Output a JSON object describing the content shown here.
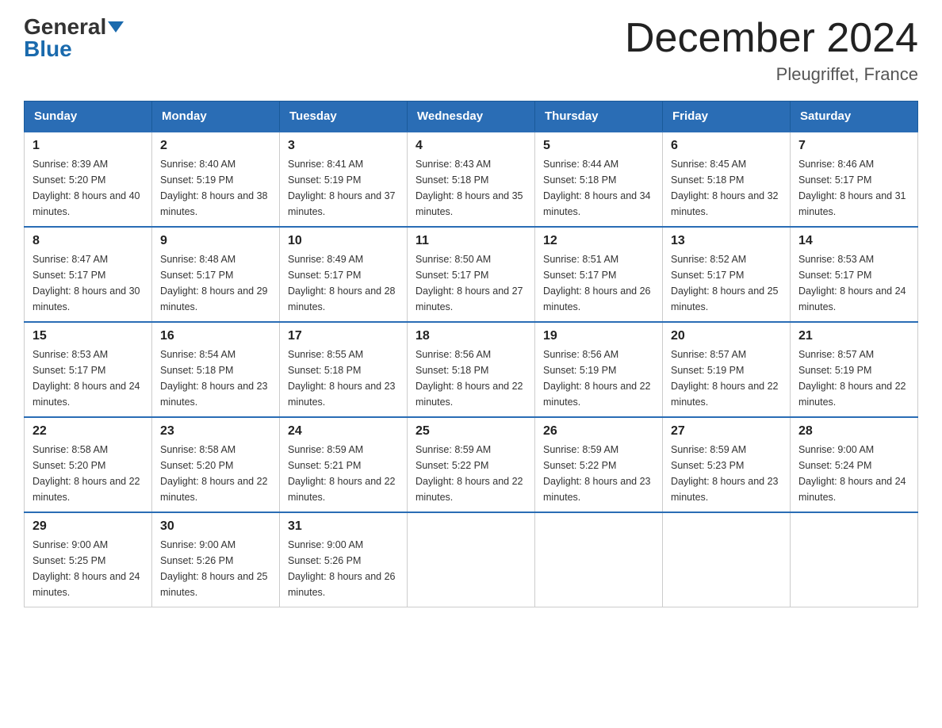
{
  "header": {
    "logo": {
      "general": "General",
      "blue": "Blue",
      "triangle": true
    },
    "title": "December 2024",
    "location": "Pleugriffet, France"
  },
  "calendar": {
    "days_of_week": [
      "Sunday",
      "Monday",
      "Tuesday",
      "Wednesday",
      "Thursday",
      "Friday",
      "Saturday"
    ],
    "weeks": [
      [
        {
          "day": "1",
          "sunrise": "8:39 AM",
          "sunset": "5:20 PM",
          "daylight": "8 hours and 40 minutes."
        },
        {
          "day": "2",
          "sunrise": "8:40 AM",
          "sunset": "5:19 PM",
          "daylight": "8 hours and 38 minutes."
        },
        {
          "day": "3",
          "sunrise": "8:41 AM",
          "sunset": "5:19 PM",
          "daylight": "8 hours and 37 minutes."
        },
        {
          "day": "4",
          "sunrise": "8:43 AM",
          "sunset": "5:18 PM",
          "daylight": "8 hours and 35 minutes."
        },
        {
          "day": "5",
          "sunrise": "8:44 AM",
          "sunset": "5:18 PM",
          "daylight": "8 hours and 34 minutes."
        },
        {
          "day": "6",
          "sunrise": "8:45 AM",
          "sunset": "5:18 PM",
          "daylight": "8 hours and 32 minutes."
        },
        {
          "day": "7",
          "sunrise": "8:46 AM",
          "sunset": "5:17 PM",
          "daylight": "8 hours and 31 minutes."
        }
      ],
      [
        {
          "day": "8",
          "sunrise": "8:47 AM",
          "sunset": "5:17 PM",
          "daylight": "8 hours and 30 minutes."
        },
        {
          "day": "9",
          "sunrise": "8:48 AM",
          "sunset": "5:17 PM",
          "daylight": "8 hours and 29 minutes."
        },
        {
          "day": "10",
          "sunrise": "8:49 AM",
          "sunset": "5:17 PM",
          "daylight": "8 hours and 28 minutes."
        },
        {
          "day": "11",
          "sunrise": "8:50 AM",
          "sunset": "5:17 PM",
          "daylight": "8 hours and 27 minutes."
        },
        {
          "day": "12",
          "sunrise": "8:51 AM",
          "sunset": "5:17 PM",
          "daylight": "8 hours and 26 minutes."
        },
        {
          "day": "13",
          "sunrise": "8:52 AM",
          "sunset": "5:17 PM",
          "daylight": "8 hours and 25 minutes."
        },
        {
          "day": "14",
          "sunrise": "8:53 AM",
          "sunset": "5:17 PM",
          "daylight": "8 hours and 24 minutes."
        }
      ],
      [
        {
          "day": "15",
          "sunrise": "8:53 AM",
          "sunset": "5:17 PM",
          "daylight": "8 hours and 24 minutes."
        },
        {
          "day": "16",
          "sunrise": "8:54 AM",
          "sunset": "5:18 PM",
          "daylight": "8 hours and 23 minutes."
        },
        {
          "day": "17",
          "sunrise": "8:55 AM",
          "sunset": "5:18 PM",
          "daylight": "8 hours and 23 minutes."
        },
        {
          "day": "18",
          "sunrise": "8:56 AM",
          "sunset": "5:18 PM",
          "daylight": "8 hours and 22 minutes."
        },
        {
          "day": "19",
          "sunrise": "8:56 AM",
          "sunset": "5:19 PM",
          "daylight": "8 hours and 22 minutes."
        },
        {
          "day": "20",
          "sunrise": "8:57 AM",
          "sunset": "5:19 PM",
          "daylight": "8 hours and 22 minutes."
        },
        {
          "day": "21",
          "sunrise": "8:57 AM",
          "sunset": "5:19 PM",
          "daylight": "8 hours and 22 minutes."
        }
      ],
      [
        {
          "day": "22",
          "sunrise": "8:58 AM",
          "sunset": "5:20 PM",
          "daylight": "8 hours and 22 minutes."
        },
        {
          "day": "23",
          "sunrise": "8:58 AM",
          "sunset": "5:20 PM",
          "daylight": "8 hours and 22 minutes."
        },
        {
          "day": "24",
          "sunrise": "8:59 AM",
          "sunset": "5:21 PM",
          "daylight": "8 hours and 22 minutes."
        },
        {
          "day": "25",
          "sunrise": "8:59 AM",
          "sunset": "5:22 PM",
          "daylight": "8 hours and 22 minutes."
        },
        {
          "day": "26",
          "sunrise": "8:59 AM",
          "sunset": "5:22 PM",
          "daylight": "8 hours and 23 minutes."
        },
        {
          "day": "27",
          "sunrise": "8:59 AM",
          "sunset": "5:23 PM",
          "daylight": "8 hours and 23 minutes."
        },
        {
          "day": "28",
          "sunrise": "9:00 AM",
          "sunset": "5:24 PM",
          "daylight": "8 hours and 24 minutes."
        }
      ],
      [
        {
          "day": "29",
          "sunrise": "9:00 AM",
          "sunset": "5:25 PM",
          "daylight": "8 hours and 24 minutes."
        },
        {
          "day": "30",
          "sunrise": "9:00 AM",
          "sunset": "5:26 PM",
          "daylight": "8 hours and 25 minutes."
        },
        {
          "day": "31",
          "sunrise": "9:00 AM",
          "sunset": "5:26 PM",
          "daylight": "8 hours and 26 minutes."
        },
        null,
        null,
        null,
        null
      ]
    ]
  }
}
